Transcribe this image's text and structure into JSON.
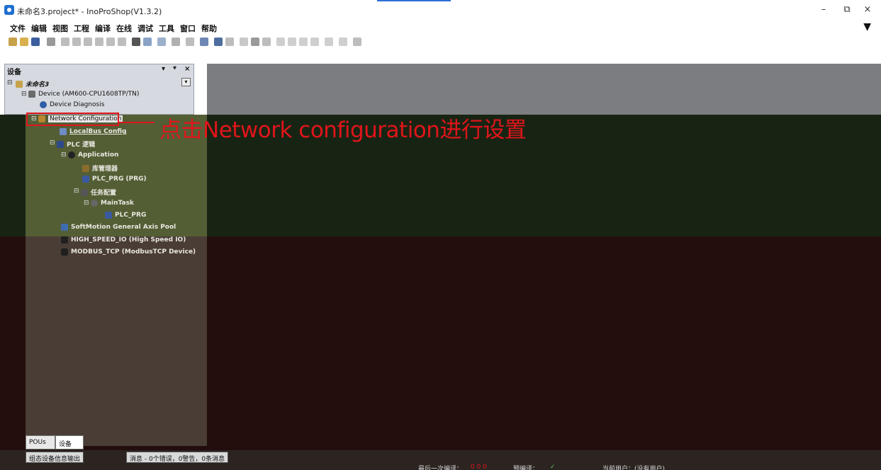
{
  "window": {
    "title": "未命名3.project* - InoProShop(V1.3.2)",
    "controls": {
      "minimize": "–",
      "maximize": "⧉",
      "close": "×"
    }
  },
  "menu": {
    "items": [
      "文件",
      "编辑",
      "视图",
      "工程",
      "编译",
      "在线",
      "调试",
      "工具",
      "窗口",
      "帮助"
    ]
  },
  "panel": {
    "title": "设备",
    "controls": {
      "dropdown": "▾",
      "pin": "ᵠ",
      "close": "×"
    }
  },
  "tree": {
    "root": "未命名3",
    "device": "Device (AM600-CPU1608TP/TN)",
    "diagnosis": "Device Diagnosis",
    "network_config": "Network Configuration",
    "localbus": "LocalBus Config",
    "plc_logic": "PLC 逻辑",
    "application": "Application",
    "library_manager": "库管理器",
    "plc_prg": "PLC_PRG (PRG)",
    "task_config": "任务配置",
    "main_task": "MainTask",
    "plc_prg_call": "PLC_PRG",
    "softmotion": "SoftMotion General Axis Pool",
    "high_speed_io": "HIGH_SPEED_IO (High Speed IO)",
    "modbus": "MODBUS_TCP (ModbusTCP Device)"
  },
  "annotation": "点击Network configuration进行设置",
  "bottom_tabs": {
    "pous": "POUs",
    "devices": "设备"
  },
  "status_tabs": {
    "output": "组态设备信息输出",
    "messages": "消息 - 0个错误，0警告，0条消息"
  },
  "status": {
    "last_build": "最后一次编译：",
    "build_counts": "0 0 0",
    "precompile": "预编译：",
    "precompile_state": "✓",
    "current_user": "当前用户：(没有用户)"
  },
  "colors": {
    "accent_red": "#e0151b",
    "window_blue": "#2f6fd6"
  }
}
